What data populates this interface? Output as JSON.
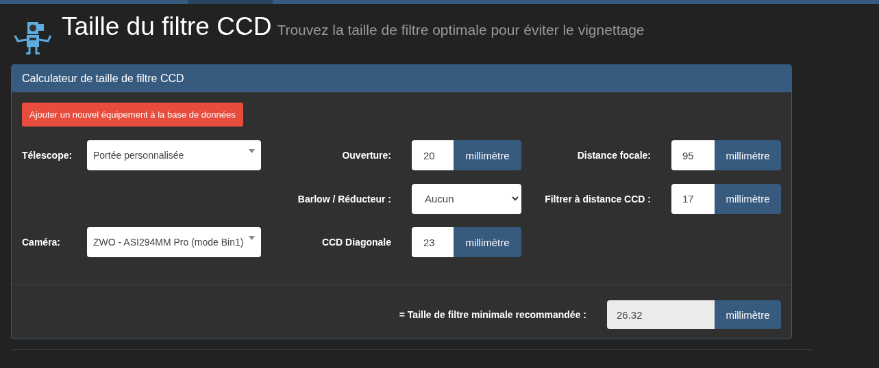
{
  "header": {
    "title": "Taille du filtre CCD",
    "subtitle": "Trouvez la taille de filtre optimale pour éviter le vignettage"
  },
  "panel": {
    "title": "Calculateur de taille de filtre CCD",
    "add_button": "Ajouter un nouvel équipement à la base de données",
    "rows": [
      {
        "left": {
          "kind": "dropdown",
          "label": "Télescope:",
          "value": "Portée personnalisée"
        },
        "middle": {
          "kind": "number",
          "label": "Ouverture:",
          "value": "20",
          "unit": "millimètre"
        },
        "right": {
          "kind": "number",
          "label": "Distance focale:",
          "value": "95",
          "unit": "millimètre"
        }
      },
      {
        "middle": {
          "kind": "select",
          "label": "Barlow / Réducteur :",
          "value": "Aucun"
        },
        "right": {
          "kind": "number",
          "label": "Filtrer à distance CCD :",
          "value": "17",
          "unit": "millimètre"
        }
      },
      {
        "left": {
          "kind": "dropdown",
          "label": "Caméra:",
          "value": "ZWO - ASI294MM Pro (mode Bin1)"
        },
        "middle": {
          "kind": "number",
          "label": "CCD Diagonale",
          "value": "23",
          "unit": "millimètre"
        }
      }
    ],
    "result": {
      "label": "= Taille de filtre minimale recommandée :",
      "value": "26.32",
      "unit": "millimètre"
    }
  }
}
